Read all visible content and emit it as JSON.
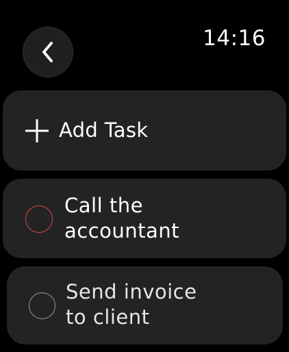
{
  "status": {
    "time": "14:16"
  },
  "header": {
    "back_icon": "chevron-left-icon"
  },
  "add_task": {
    "icon": "plus-icon",
    "label": "Add Task"
  },
  "tasks": [
    {
      "title": "Call the\naccountant",
      "completed": false,
      "circle_color": "#e0454a"
    },
    {
      "title": "Send invoice\nto client",
      "completed": false,
      "circle_color": "#9a9a9a"
    }
  ],
  "colors": {
    "background": "#000000",
    "card": "#232323",
    "text": "#ffffff"
  }
}
